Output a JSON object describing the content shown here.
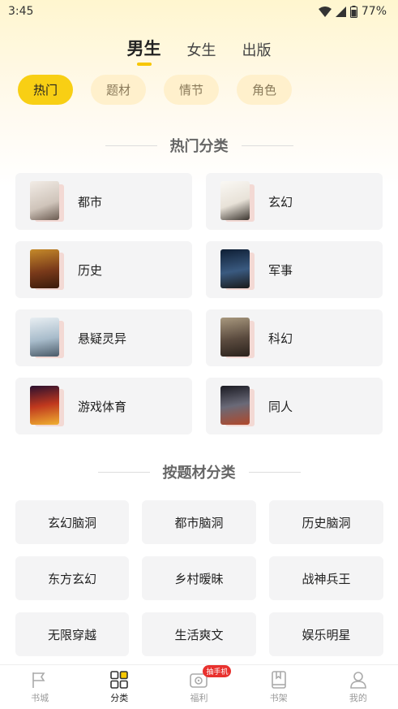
{
  "status": {
    "time": "3:45",
    "battery": "77%"
  },
  "top_tabs": [
    {
      "label": "男生",
      "active": true
    },
    {
      "label": "女生",
      "active": false
    },
    {
      "label": "出版",
      "active": false
    }
  ],
  "filters": [
    {
      "label": "热门",
      "active": true
    },
    {
      "label": "题材",
      "active": false
    },
    {
      "label": "情节",
      "active": false
    },
    {
      "label": "角色",
      "active": false
    }
  ],
  "hot_section": {
    "title": "热门分类",
    "categories": [
      {
        "label": "都市",
        "cover_color": "#e8e0d8"
      },
      {
        "label": "玄幻",
        "cover_color": "#f0ede8"
      },
      {
        "label": "历史",
        "cover_color": "#7a3a1a"
      },
      {
        "label": "军事",
        "cover_color": "#1f3a5a"
      },
      {
        "label": "悬疑灵异",
        "cover_color": "#c9d6e0"
      },
      {
        "label": "科幻",
        "cover_color": "#5a4a3e"
      },
      {
        "label": "游戏体育",
        "cover_color": "#8a1e1e"
      },
      {
        "label": "同人",
        "cover_color": "#2a2a34"
      }
    ]
  },
  "theme_section": {
    "title": "按题材分类",
    "tags": [
      "玄幻脑洞",
      "都市脑洞",
      "历史脑洞",
      "东方玄幻",
      "乡村暧昧",
      "战神兵王",
      "无限穿越",
      "生活爽文",
      "娱乐明星"
    ]
  },
  "bottom_nav": [
    {
      "label": "书城",
      "icon": "flag-icon",
      "active": false
    },
    {
      "label": "分类",
      "icon": "grid-icon",
      "active": true
    },
    {
      "label": "福利",
      "icon": "gift-icon",
      "active": false,
      "badge": "抽手机"
    },
    {
      "label": "书架",
      "icon": "book-icon",
      "active": false
    },
    {
      "label": "我的",
      "icon": "user-icon",
      "active": false
    }
  ]
}
